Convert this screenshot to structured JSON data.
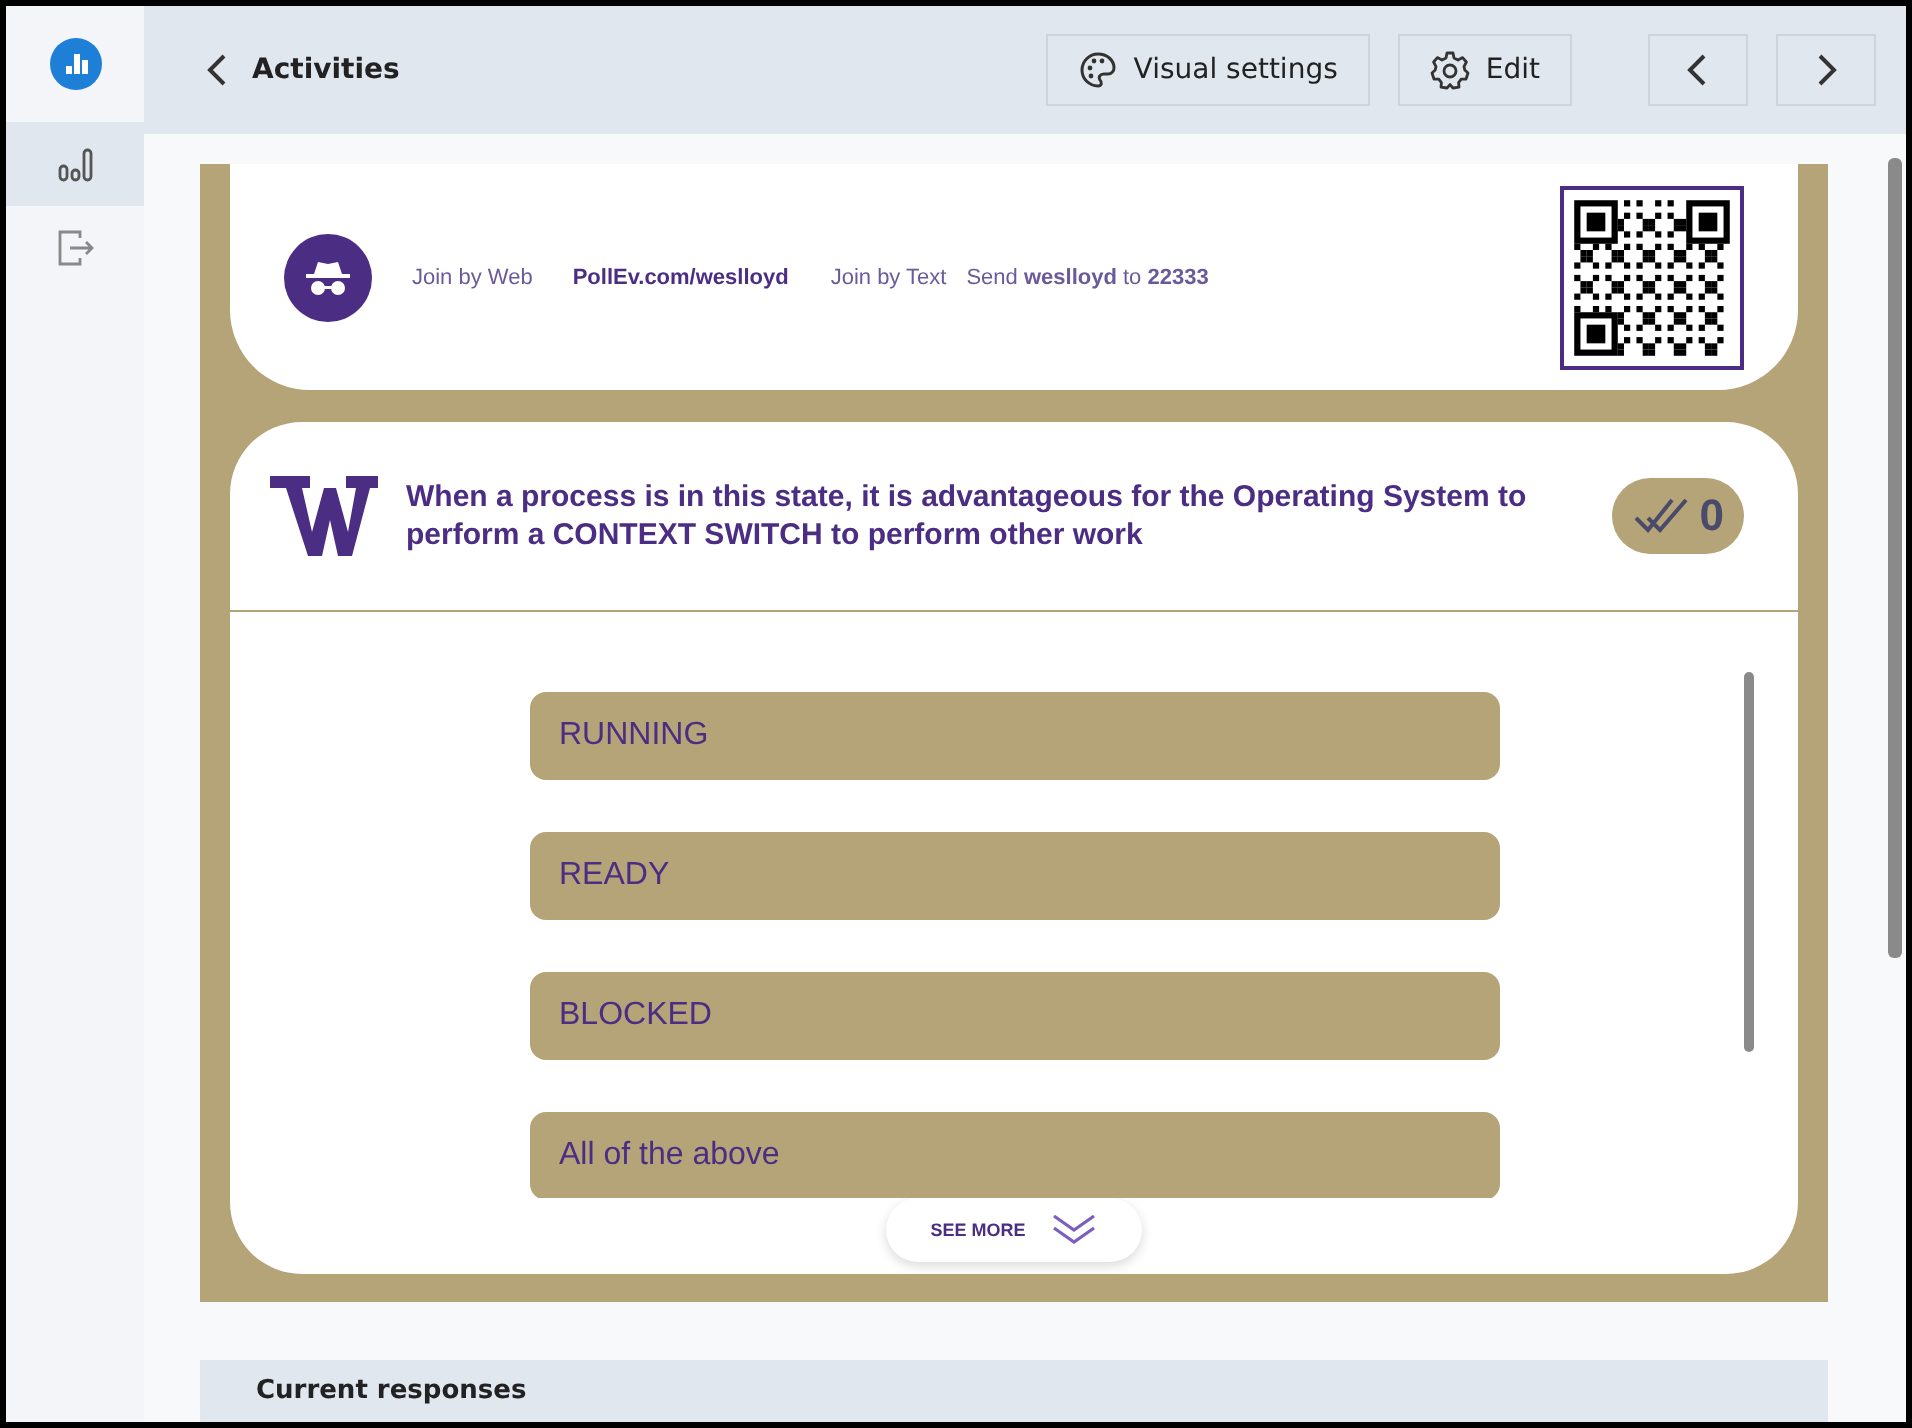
{
  "header": {
    "back_label": "Activities",
    "buttons": [
      {
        "label": "Visual settings",
        "kind": "palette"
      },
      {
        "label": "Edit",
        "kind": "gear"
      }
    ]
  },
  "sidebar": {
    "items": [
      {
        "kind": "chart",
        "selected": true
      },
      {
        "kind": "exit",
        "selected": false
      }
    ]
  },
  "join": {
    "web_label": "Join by Web",
    "web_url": "PollEv.com/weslloyd",
    "text_label": "Join by Text",
    "text_instruction": "Send **weslloyd** to **22333**"
  },
  "question": {
    "title": "When a process is in this state, it is advantageous for the Operating System to perform a CONTEXT SWITCH to perform other work",
    "response_count": "0",
    "see_more": "SEE MORE",
    "options": [
      {
        "label": "RUNNING"
      },
      {
        "label": "READY"
      },
      {
        "label": "BLOCKED"
      },
      {
        "label": "All of the above"
      }
    ]
  },
  "responses": {
    "title": "Current responses"
  }
}
